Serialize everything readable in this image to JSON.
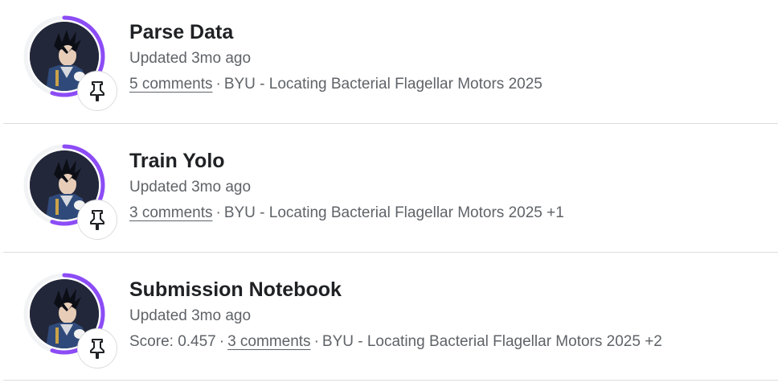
{
  "colors": {
    "ring_active": "#8c4cf5",
    "ring_track": "#f1f3f4",
    "divider": "#dadce0",
    "title": "#202124",
    "meta": "#5f6368"
  },
  "separator": "·",
  "notebooks": [
    {
      "title": "Parse Data",
      "updated": "Updated 3mo ago",
      "score": "",
      "comments": "5 comments",
      "competition": "BYU - Locating Bacterial Flagellar Motors 2025",
      "extra": "",
      "ring_progress": 0.55,
      "pin_icon": "pin-icon"
    },
    {
      "title": "Train Yolo",
      "updated": "Updated 3mo ago",
      "score": "",
      "comments": "3 comments",
      "competition": "BYU - Locating Bacterial Flagellar Motors 2025",
      "extra": "+1",
      "ring_progress": 0.55,
      "pin_icon": "pin-icon"
    },
    {
      "title": "Submission Notebook",
      "updated": "Updated 3mo ago",
      "score": "Score: 0.457",
      "comments": "3 comments",
      "competition": "BYU - Locating Bacterial Flagellar Motors 2025",
      "extra": "+2",
      "ring_progress": 0.55,
      "pin_icon": "pin-icon"
    }
  ]
}
